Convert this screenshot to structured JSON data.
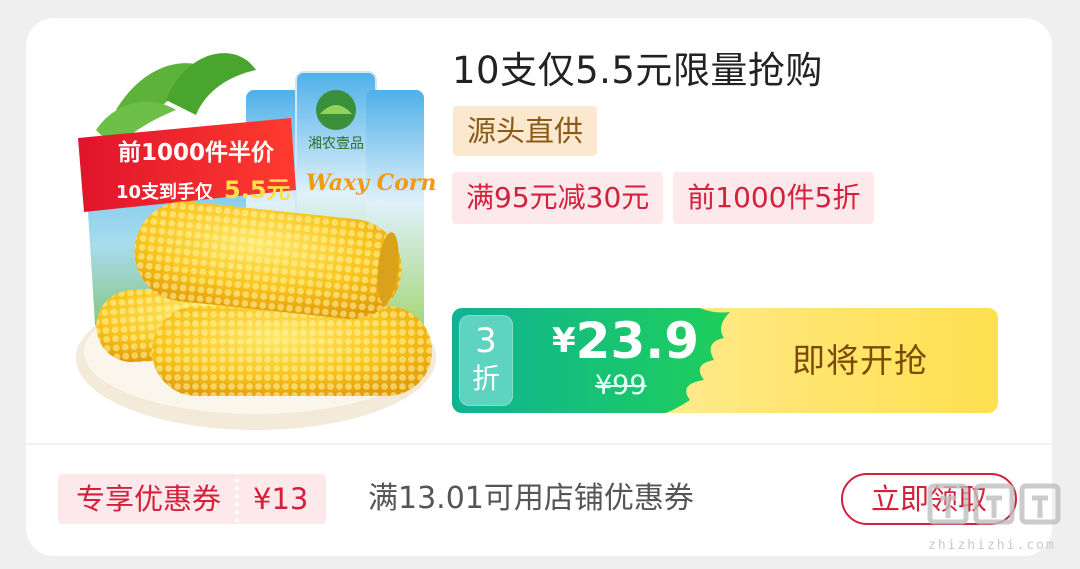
{
  "product": {
    "image_icon": "corn-product-image",
    "image_overlay": {
      "line1": "前1000件半价",
      "line2_prefix": "10支到手仅",
      "line2_price": "5.5元"
    },
    "packaging_text": "Waxy Corn",
    "brand_text": "湘农壹品",
    "title": "10支仅5.5元限量抢购",
    "source_tag": "源头直供",
    "promo_tags": [
      "满95元减30元",
      "前1000件5折"
    ]
  },
  "price_bar": {
    "discount_number": "3",
    "discount_unit": "折",
    "currency": "¥",
    "price": "23.9",
    "original_price": "¥99",
    "cta_label": "即将开抢"
  },
  "coupon": {
    "label": "专享优惠券",
    "value": "¥13",
    "description": "满13.01可用店铺优惠券",
    "claim_label": "立即领取"
  },
  "watermark": {
    "site": "zhizhizhi.com"
  },
  "colors": {
    "accent_red": "#d4203a",
    "price_green": "#17c080",
    "cta_yellow": "#ffe04f",
    "source_tag_bg": "#fbe8cf"
  }
}
